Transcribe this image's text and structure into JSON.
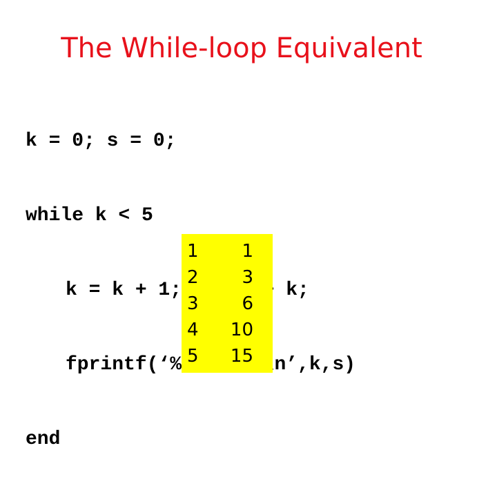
{
  "slide": {
    "title": "The While-loop Equivalent",
    "title_color": "#e8111b",
    "code_lines": [
      "k = 0; s = 0;",
      "while k < 5",
      "k = k + 1; s = s + k;",
      "fprintf(‘%2d  %2d\\n’,k,s)",
      "end"
    ],
    "output": {
      "background_color": "#ffff00",
      "rows": [
        {
          "k": "1",
          "s": "1"
        },
        {
          "k": "2",
          "s": "3"
        },
        {
          "k": "3",
          "s": "6"
        },
        {
          "k": "4",
          "s": "10"
        },
        {
          "k": "5",
          "s": "15"
        }
      ]
    }
  }
}
